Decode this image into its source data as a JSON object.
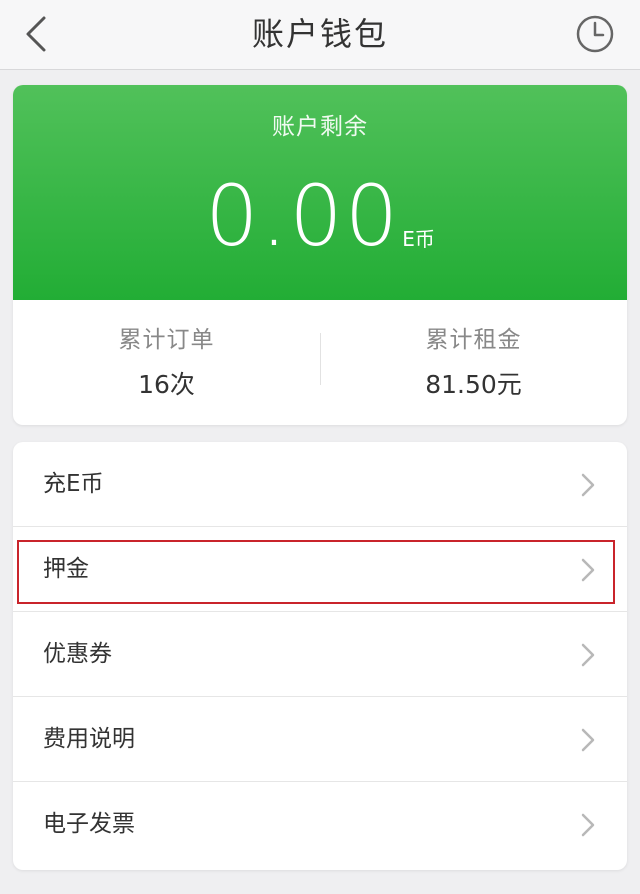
{
  "header": {
    "title": "账户钱包",
    "back_icon": "chevron-left-icon",
    "history_icon": "clock-icon"
  },
  "balance": {
    "label": "账户剩余",
    "value": "0.00",
    "unit": "E币"
  },
  "stats": [
    {
      "label": "累计订单",
      "value": "16次"
    },
    {
      "label": "累计租金",
      "value": "81.50元"
    }
  ],
  "menu": {
    "items": [
      {
        "label": "充E币"
      },
      {
        "label": "押金"
      },
      {
        "label": "优惠券"
      },
      {
        "label": "费用说明"
      },
      {
        "label": "电子发票"
      }
    ],
    "chevron_icon": "chevron-right-icon"
  },
  "colors": {
    "accent_green": "#2db33c",
    "highlight_red": "#c9242b",
    "background": "#efeff1"
  }
}
